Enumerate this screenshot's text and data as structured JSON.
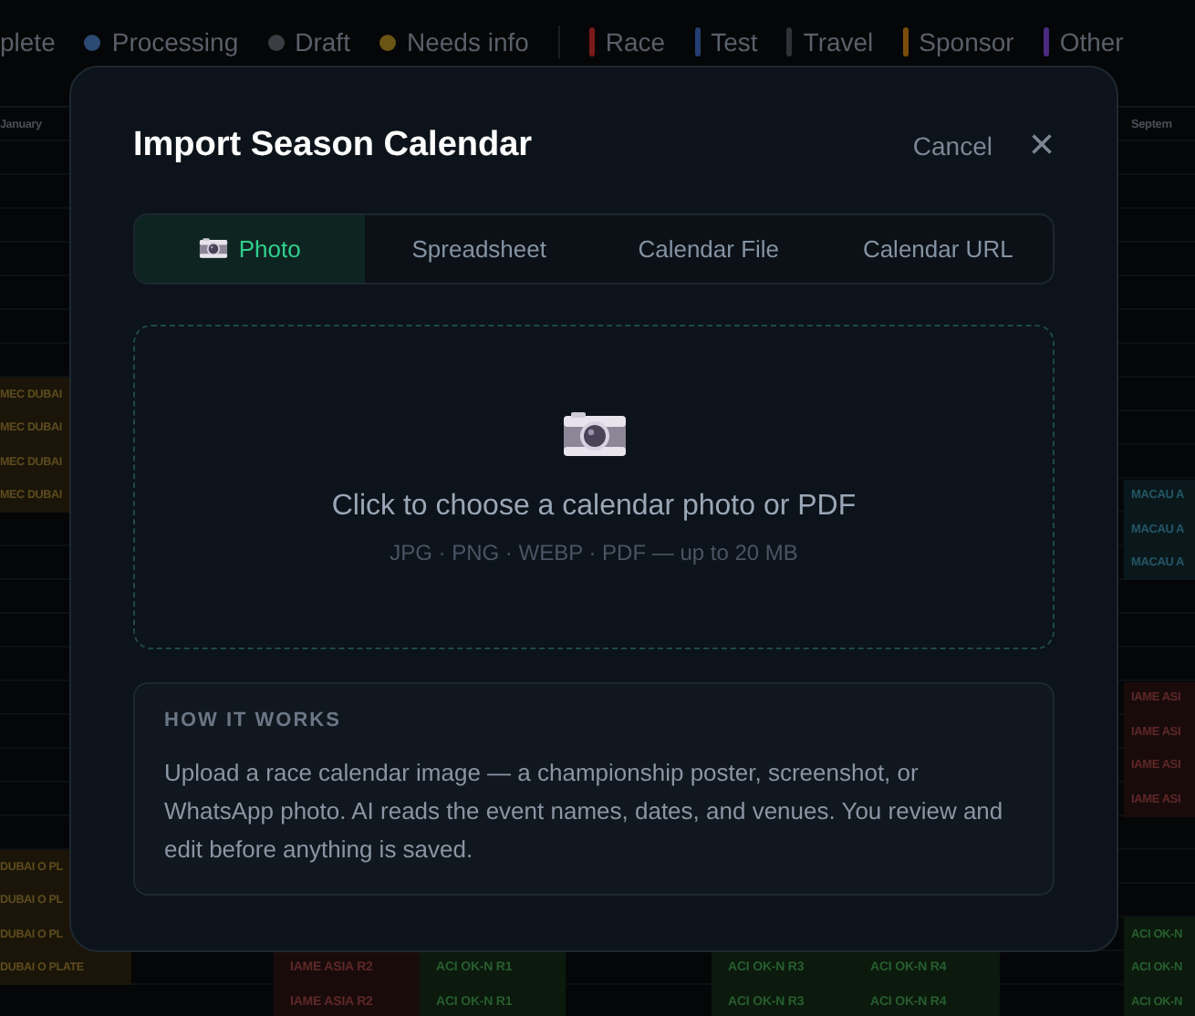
{
  "legend": {
    "statuses": [
      {
        "label": "plete"
      },
      {
        "label": "Processing",
        "color": "#2b4a73"
      },
      {
        "label": "Draft",
        "color": "#3a3d42"
      },
      {
        "label": "Needs info",
        "color": "#6b5414"
      }
    ],
    "categories": [
      {
        "label": "Race",
        "color": "#7a1a1a"
      },
      {
        "label": "Test",
        "color": "#223e73"
      },
      {
        "label": "Travel",
        "color": "#2e3237"
      },
      {
        "label": "Sponsor",
        "color": "#7a4d0a"
      },
      {
        "label": "Other",
        "color": "#4a2a80"
      }
    ]
  },
  "calendar": {
    "columns": [
      "January",
      null,
      null,
      null,
      null,
      null,
      null,
      null,
      "Septem"
    ],
    "rows": [
      [
        null,
        null,
        null,
        null,
        null,
        null,
        null,
        null,
        null
      ],
      [
        null,
        null,
        null,
        null,
        null,
        null,
        null,
        null,
        null
      ],
      [
        null,
        null,
        null,
        null,
        null,
        null,
        null,
        null,
        null
      ],
      [
        null,
        null,
        null,
        null,
        null,
        null,
        null,
        null,
        null
      ],
      [
        null,
        null,
        null,
        null,
        null,
        null,
        null,
        null,
        null
      ],
      [
        null,
        null,
        null,
        null,
        null,
        null,
        null,
        null,
        null
      ],
      [
        null,
        null,
        null,
        null,
        null,
        null,
        null,
        null,
        null
      ],
      [
        {
          "label": "MEC DUBAI",
          "color": "#1a1508"
        },
        null,
        null,
        null,
        null,
        null,
        null,
        null,
        null
      ],
      [
        {
          "label": "MEC DUBAI",
          "color": "#1a1508"
        },
        null,
        null,
        null,
        null,
        null,
        null,
        null,
        null
      ],
      [
        {
          "label": "MEC DUBAI",
          "color": "#1a1508"
        },
        null,
        null,
        null,
        null,
        null,
        null,
        null,
        null
      ],
      [
        {
          "label": "MEC DUBAI",
          "color": "#1a1508"
        },
        null,
        null,
        null,
        null,
        null,
        null,
        null,
        {
          "label": "MACAU A",
          "color": "#0a181c"
        }
      ],
      [
        null,
        null,
        null,
        null,
        null,
        null,
        null,
        null,
        {
          "label": "MACAU A",
          "color": "#0a181c"
        }
      ],
      [
        null,
        null,
        null,
        null,
        null,
        null,
        null,
        null,
        {
          "label": "MACAU A",
          "color": "#0a181c"
        }
      ],
      [
        null,
        null,
        null,
        null,
        null,
        null,
        null,
        null,
        null
      ],
      [
        null,
        null,
        null,
        null,
        null,
        null,
        null,
        null,
        null
      ],
      [
        null,
        null,
        null,
        null,
        null,
        null,
        null,
        null,
        null
      ],
      [
        null,
        null,
        null,
        null,
        null,
        null,
        null,
        null,
        {
          "label": "IAME ASI",
          "color": "#1a0b0b"
        }
      ],
      [
        null,
        null,
        null,
        null,
        null,
        null,
        null,
        null,
        {
          "label": "IAME ASI",
          "color": "#1a0b0b"
        }
      ],
      [
        null,
        null,
        null,
        null,
        null,
        null,
        null,
        null,
        {
          "label": "IAME ASI",
          "color": "#1a0b0b"
        }
      ],
      [
        null,
        null,
        null,
        null,
        null,
        null,
        null,
        null,
        {
          "label": "IAME ASI",
          "color": "#1a0b0b"
        }
      ],
      [
        null,
        null,
        null,
        null,
        null,
        null,
        null,
        null,
        null
      ],
      [
        {
          "label": "DUBAI O PL",
          "color": "#1a1508"
        },
        null,
        null,
        null,
        null,
        null,
        null,
        null,
        null
      ],
      [
        {
          "label": "DUBAI O PL",
          "color": "#1a1508"
        },
        null,
        null,
        null,
        null,
        null,
        null,
        null,
        null
      ],
      [
        {
          "label": "DUBAI O PL",
          "color": "#1a1508"
        },
        null,
        null,
        null,
        null,
        null,
        null,
        null,
        {
          "label": "ACI OK-N",
          "color": "#0b1a0d"
        }
      ],
      [
        {
          "label": "DUBAI O PLATE",
          "color": "#1a1508"
        },
        null,
        {
          "label": "IAME ASIA R2",
          "color": "#1a0b0b"
        },
        {
          "label": "ACI OK-N R1",
          "color": "#0b1a0d"
        },
        null,
        {
          "label": "ACI OK-N R3",
          "color": "#0b1a0d"
        },
        {
          "label": "ACI OK-N R4",
          "color": "#0b1a0d"
        },
        null,
        {
          "label": "ACI OK-N",
          "color": "#0b1a0d"
        }
      ],
      [
        null,
        null,
        {
          "label": "IAME ASIA R2",
          "color": "#1a0b0b"
        },
        {
          "label": "ACI OK-N R1",
          "color": "#0b1a0d"
        },
        null,
        {
          "label": "ACI OK-N R3",
          "color": "#0b1a0d"
        },
        {
          "label": "ACI OK-N R4",
          "color": "#0b1a0d"
        },
        null,
        {
          "label": "ACI OK-N",
          "color": "#0b1a0d"
        }
      ]
    ]
  },
  "dialog": {
    "title": "Import Season Calendar",
    "cancel": "Cancel",
    "close": "×",
    "tabs": [
      {
        "label": "Photo",
        "selected": true
      },
      {
        "label": "Spreadsheet",
        "selected": false
      },
      {
        "label": "Calendar File",
        "selected": false
      },
      {
        "label": "Calendar URL",
        "selected": false
      }
    ],
    "dropzone": {
      "prompt": "Click to choose a calendar photo or PDF",
      "formats": "JPG · PNG · WEBP · PDF — up to 20 MB"
    },
    "how_it_works": {
      "heading": "HOW IT WORKS",
      "text": "Upload a race calendar image — a championship poster, screenshot, or WhatsApp photo. AI reads the event names, dates, and venues. You review and edit before anything is saved."
    }
  }
}
